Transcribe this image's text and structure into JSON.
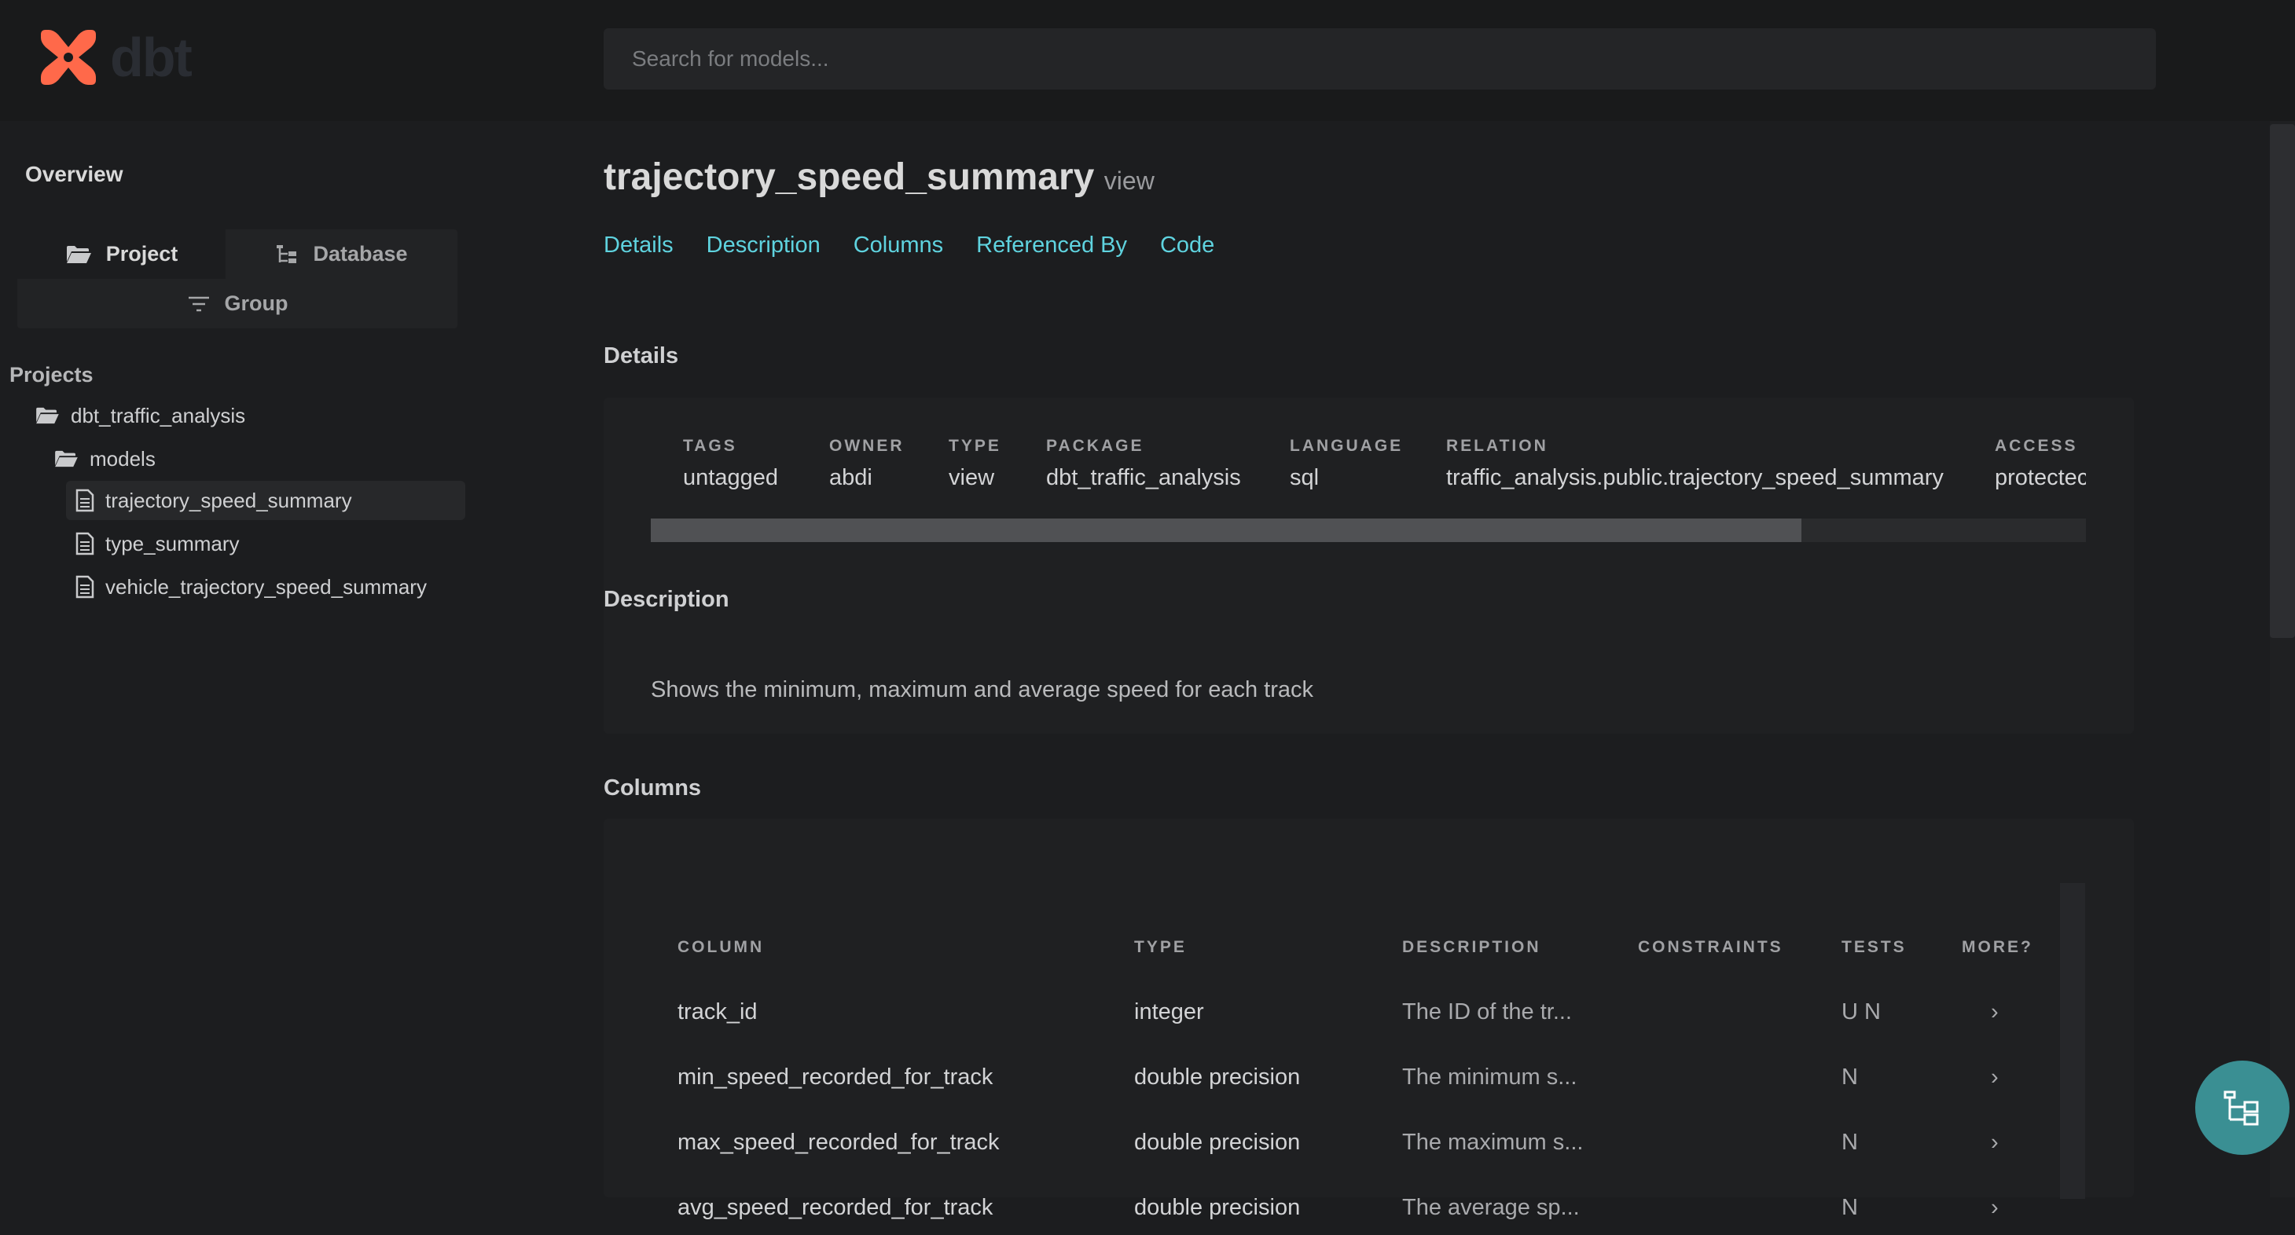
{
  "header": {
    "logo_text": "dbt",
    "search_placeholder": "Search for models..."
  },
  "sidebar": {
    "overview": "Overview",
    "tabs": {
      "project": "Project",
      "database": "Database",
      "group": "Group"
    },
    "projects_label": "Projects",
    "tree": {
      "project": "dbt_traffic_analysis",
      "folder": "models",
      "files": [
        "trajectory_speed_summary",
        "type_summary",
        "vehicle_trajectory_speed_summary"
      ]
    }
  },
  "model": {
    "name": "trajectory_speed_summary",
    "kind": "view",
    "tabs": [
      "Details",
      "Description",
      "Columns",
      "Referenced By",
      "Code"
    ]
  },
  "details": {
    "title": "Details",
    "fields": [
      {
        "label": "TAGS",
        "value": "untagged"
      },
      {
        "label": "OWNER",
        "value": "abdi"
      },
      {
        "label": "TYPE",
        "value": "view"
      },
      {
        "label": "PACKAGE",
        "value": "dbt_traffic_analysis"
      },
      {
        "label": "LANGUAGE",
        "value": "sql"
      },
      {
        "label": "RELATION",
        "value": "traffic_analysis.public.trajectory_speed_summary"
      },
      {
        "label": "ACCESS",
        "value": "protectec"
      }
    ]
  },
  "description": {
    "title": "Description",
    "text": "Shows the minimum, maximum and average speed for each track"
  },
  "columns": {
    "title": "Columns",
    "headers": [
      "COLUMN",
      "TYPE",
      "DESCRIPTION",
      "CONSTRAINTS",
      "TESTS",
      "MORE?"
    ],
    "rows": [
      {
        "column": "track_id",
        "type": "integer",
        "description": "The ID of the tr...",
        "constraints": "",
        "tests": "U N",
        "more": "›"
      },
      {
        "column": "min_speed_recorded_for_track",
        "type": "double precision",
        "description": "The minimum s...",
        "constraints": "",
        "tests": "N",
        "more": "›"
      },
      {
        "column": "max_speed_recorded_for_track",
        "type": "double precision",
        "description": "The maximum s...",
        "constraints": "",
        "tests": "N",
        "more": "›"
      },
      {
        "column": "avg_speed_recorded_for_track",
        "type": "double precision",
        "description": "The average sp...",
        "constraints": "",
        "tests": "N",
        "more": "›"
      }
    ]
  },
  "colors": {
    "accent": "#5fd3df",
    "logo": "#ff694a",
    "fab": "#3a8f93"
  }
}
